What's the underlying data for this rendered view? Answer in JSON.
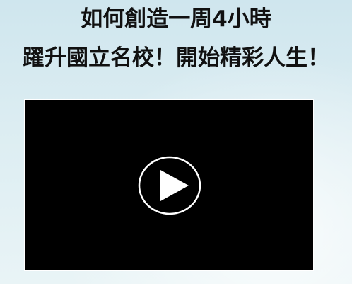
{
  "headline": {
    "line1": "如何創造一周4小時",
    "line2": "躍升國立名校！開始精彩人生！"
  },
  "video": {
    "play_icon": "play-circle-icon",
    "background": "#000000"
  }
}
